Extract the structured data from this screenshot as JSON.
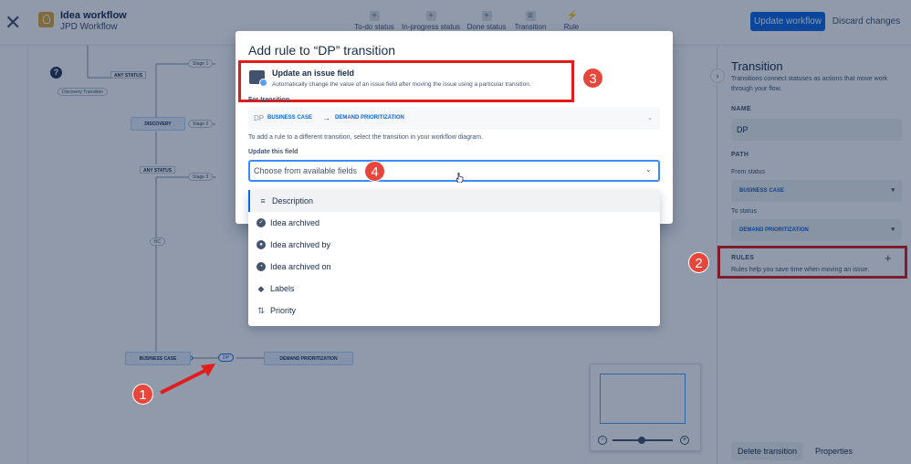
{
  "header": {
    "title": "Idea workflow",
    "subtitle": "JPD Workflow",
    "toolbar": [
      {
        "label": "To-do status"
      },
      {
        "label": "In-progress status"
      },
      {
        "label": "Done status"
      },
      {
        "label": "Transition"
      },
      {
        "label": "Rule"
      }
    ],
    "update_label": "Update workflow",
    "discard_label": "Discard changes"
  },
  "diagram": {
    "stage1": "Stage 1",
    "stage2": "Stage 2",
    "stage3": "Stage 3",
    "any_status_1": "ANY STATUS",
    "any_status_2": "ANY STATUS",
    "discovery_transition": "Discovery Transition",
    "discovery": "DISCOVERY",
    "bc": "BC",
    "business_case": "BUSINESS CASE",
    "dp": "DP",
    "demand_prioritization": "DEMAND PRIORITIZATION"
  },
  "panel": {
    "title": "Transition",
    "description": "Transitions connect statuses as actions that move work through your flow.",
    "name_label": "NAME",
    "name_value": "DP",
    "path_label": "PATH",
    "from_label": "From status",
    "from_value": "BUSINESS CASE",
    "to_label": "To status",
    "to_value": "DEMAND PRIORITIZATION",
    "rules_label": "RULES",
    "rules_help": "Rules help you save time when moving an issue.",
    "delete_label": "Delete transition",
    "properties_label": "Properties"
  },
  "modal": {
    "title": "Add rule to “DP” transition",
    "rule_name": "Update an issue field",
    "rule_desc": "Automatically change the value of an issue field after moving the issue using a particular transition.",
    "for_transition_label": "For transition",
    "transition_name": "DP",
    "transition_from": "BUSINESS CASE",
    "transition_to": "DEMAND PRIORITIZATION",
    "hint": "To add a rule to a different transition, select the transition in your workflow diagram.",
    "field_label": "Update this field",
    "field_placeholder": "Choose from available fields"
  },
  "dropdown": {
    "items": [
      {
        "label": "Description",
        "icon": "lines-icon"
      },
      {
        "label": "Idea archived",
        "icon": "check-circle-icon"
      },
      {
        "label": "Idea archived by",
        "icon": "user-circle-icon"
      },
      {
        "label": "Idea archived on",
        "icon": "clock-icon"
      },
      {
        "label": "Labels",
        "icon": "tag-icon"
      },
      {
        "label": "Priority",
        "icon": "priority-icon"
      }
    ]
  },
  "markers": {
    "m1": "1",
    "m2": "2",
    "m3": "3",
    "m4": "4"
  },
  "colors": {
    "primary": "#0c66e4",
    "callout": "#e9463b",
    "highlight": "#e01c1c"
  }
}
